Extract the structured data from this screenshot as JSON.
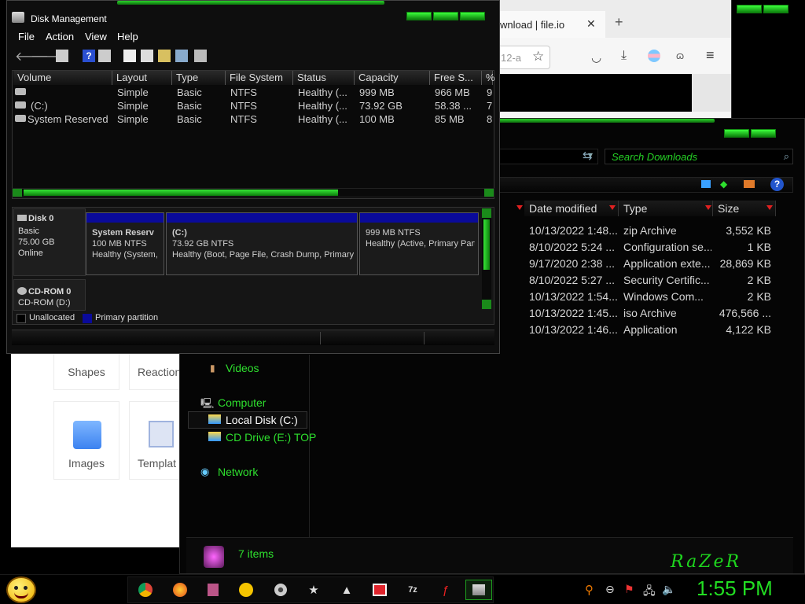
{
  "disk_management": {
    "title": "Disk Management",
    "menu": [
      "File",
      "Action",
      "View",
      "Help"
    ],
    "columns": [
      "Volume",
      "Layout",
      "Type",
      "File System",
      "Status",
      "Capacity",
      "Free S...",
      "%"
    ],
    "volumes": [
      {
        "volume": "",
        "layout": "Simple",
        "type": "Basic",
        "fs": "NTFS",
        "status": "Healthy (...",
        "capacity": "999 MB",
        "free": "966 MB",
        "pct": "9"
      },
      {
        "volume": "(C:)",
        "layout": "Simple",
        "type": "Basic",
        "fs": "NTFS",
        "status": "Healthy (...",
        "capacity": "73.92 GB",
        "free": "58.38 ...",
        "pct": "7"
      },
      {
        "volume": "System Reserved",
        "layout": "Simple",
        "type": "Basic",
        "fs": "NTFS",
        "status": "Healthy (...",
        "capacity": "100 MB",
        "free": "85 MB",
        "pct": "8"
      }
    ],
    "disk0": {
      "name": "Disk 0",
      "type": "Basic",
      "size": "75.00 GB",
      "state": "Online"
    },
    "partitions": [
      {
        "name": "System Reserv",
        "size": "100 MB NTFS",
        "status": "Healthy (System,"
      },
      {
        "name": "(C:)",
        "size": "73.92 GB NTFS",
        "status": "Healthy (Boot, Page File, Crash Dump, Primary P"
      },
      {
        "name": "",
        "size": "999 MB NTFS",
        "status": "Healthy (Active, Primary Part"
      }
    ],
    "cdrom": {
      "name": "CD-ROM 0",
      "drive": "CD-ROM (D:)"
    },
    "legend": {
      "unallocated": "Unallocated",
      "primary": "Primary partition"
    }
  },
  "browser": {
    "tab_title": "wnload | file.io",
    "url_fragment": "12-a"
  },
  "explorer": {
    "search_placeholder": "Search Downloads",
    "columns": [
      "Date modified",
      "Type",
      "Size"
    ],
    "files": [
      {
        "date": "10/13/2022 1:48...",
        "type": "zip Archive",
        "size": "3,552 KB"
      },
      {
        "date": "8/10/2022 5:24 ...",
        "type": "Configuration se...",
        "size": "1 KB"
      },
      {
        "date": "9/17/2020 2:38 ...",
        "type": "Application exte...",
        "size": "28,869 KB"
      },
      {
        "date": "8/10/2022 5:27 ...",
        "type": "Security Certific...",
        "size": "2 KB"
      },
      {
        "date": "10/13/2022 1:54...",
        "type": "Windows Com...",
        "size": "2 KB"
      },
      {
        "date": "10/13/2022 1:45...",
        "type": "iso Archive",
        "size": "476,566 ..."
      },
      {
        "date": "10/13/2022 1:46...",
        "type": "Application",
        "size": "4,122 KB"
      }
    ],
    "nav": {
      "videos": "Videos",
      "computer": "Computer",
      "local_disk": "Local Disk (C:)",
      "cd_drive": "CD Drive (E:) TOP",
      "network": "Network"
    },
    "status": "7 items",
    "brand": "RaZeR"
  },
  "white_app": {
    "tiles": [
      "Shapes",
      "Reaction",
      "Images",
      "Templat"
    ]
  },
  "taskbar": {
    "clock": "1:55 PM",
    "apps": [
      "chrome",
      "firefox",
      "media",
      "messenger",
      "dvd",
      "star",
      "arch",
      "gift",
      "7z",
      "flash",
      "diskmgmt"
    ]
  },
  "colors": {
    "accent_green": "#22dd22",
    "partition_blue": "#0a0a9a"
  }
}
